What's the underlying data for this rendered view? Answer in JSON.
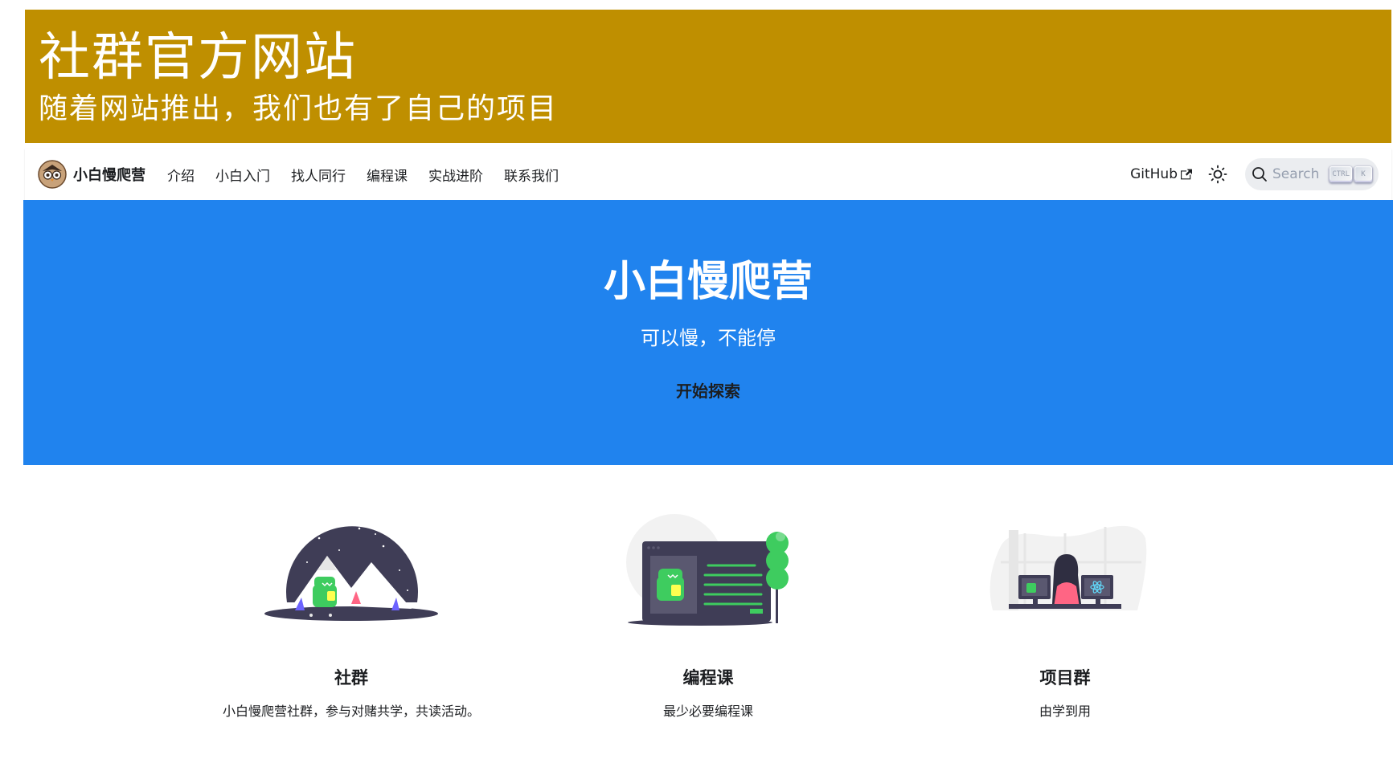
{
  "banner": {
    "title": "社群官方网站",
    "subtitle": "随着网站推出，我们也有了自己的项目"
  },
  "navbar": {
    "brand": "小白慢爬营",
    "logo_icon": "owl-logo-icon",
    "links": [
      "介绍",
      "小白入门",
      "找人同行",
      "编程课",
      "实战进阶",
      "联系我们"
    ],
    "github": "GitHub",
    "search": {
      "placeholder": "Search",
      "keys": [
        "CTRL",
        "K"
      ]
    }
  },
  "hero": {
    "title": "小白慢爬营",
    "subtitle": "可以慢，不能停",
    "button": "开始探索",
    "background": "#2083ee"
  },
  "features": [
    {
      "title": "社群",
      "description": "小白慢爬营社群，参与对赌共学，共读活动。",
      "illustration": "mountain-dino-illustration"
    },
    {
      "title": "编程课",
      "description": "最少必要编程课",
      "illustration": "screen-dino-illustration"
    },
    {
      "title": "项目群",
      "description": "由学到用",
      "illustration": "coder-desk-illustration"
    }
  ],
  "colors": {
    "banner": "#bf8f00",
    "accent": "#2083ee",
    "illustration_green": "#3ecc5f"
  }
}
